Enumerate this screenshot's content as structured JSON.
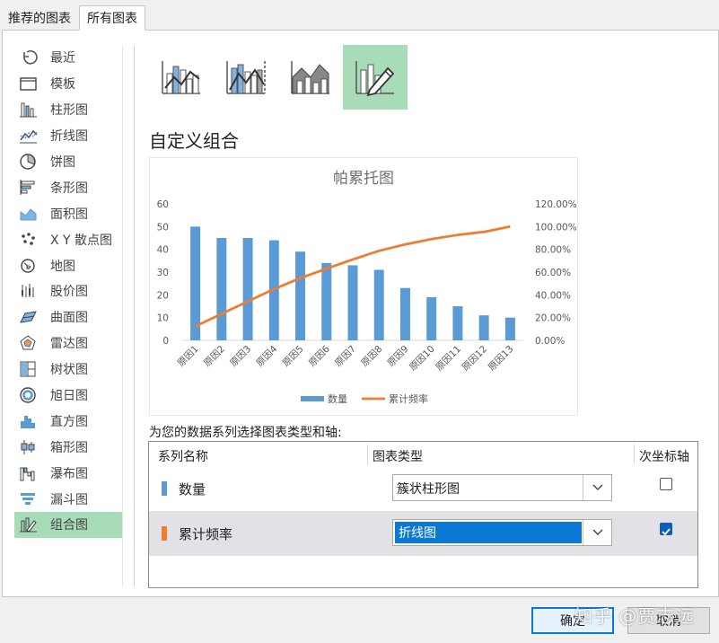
{
  "tabs": [
    {
      "label": "推荐的图表"
    },
    {
      "label": "所有图表"
    }
  ],
  "categories": [
    {
      "label": "最近",
      "icon": "recent-icon"
    },
    {
      "label": "模板",
      "icon": "template-folder-icon"
    },
    {
      "label": "柱形图",
      "icon": "column-chart-icon"
    },
    {
      "label": "折线图",
      "icon": "line-chart-icon"
    },
    {
      "label": "饼图",
      "icon": "pie-chart-icon"
    },
    {
      "label": "条形图",
      "icon": "bar-chart-icon"
    },
    {
      "label": "面积图",
      "icon": "area-chart-icon"
    },
    {
      "label": "X Y 散点图",
      "icon": "scatter-chart-icon"
    },
    {
      "label": "地图",
      "icon": "map-chart-icon"
    },
    {
      "label": "股价图",
      "icon": "stock-chart-icon"
    },
    {
      "label": "曲面图",
      "icon": "surface-chart-icon"
    },
    {
      "label": "雷达图",
      "icon": "radar-chart-icon"
    },
    {
      "label": "树状图",
      "icon": "treemap-chart-icon"
    },
    {
      "label": "旭日图",
      "icon": "sunburst-chart-icon"
    },
    {
      "label": "直方图",
      "icon": "histogram-chart-icon"
    },
    {
      "label": "箱形图",
      "icon": "box-whisker-chart-icon"
    },
    {
      "label": "瀑布图",
      "icon": "waterfall-chart-icon"
    },
    {
      "label": "漏斗图",
      "icon": "funnel-chart-icon"
    },
    {
      "label": "组合图",
      "icon": "combo-chart-icon"
    }
  ],
  "selected_category": "组合图",
  "section_title": "自定义组合",
  "instruction": "为您的数据系列选择图表类型和轴:",
  "table": {
    "headers": {
      "name": "系列名称",
      "type": "图表类型",
      "secondary": "次坐标轴"
    },
    "rows": [
      {
        "name": "数量",
        "type": "簇状柱形图",
        "secondary": false,
        "color": "#5b9bd5"
      },
      {
        "name": "累计频率",
        "type": "折线图",
        "secondary": true,
        "color": "#ed7d31"
      }
    ]
  },
  "buttons": {
    "ok": "确定",
    "cancel": "取消"
  },
  "watermark": "知乎 @贾志远",
  "colors": {
    "bar": "#5b9bd5",
    "line": "#ed7d31",
    "selected_green": "#a8dbb8",
    "focus_blue": "#0b78d7"
  },
  "chart_data": {
    "type": "bar",
    "title": "帕累托图",
    "categories": [
      "原因1",
      "原因2",
      "原因3",
      "原因4",
      "原因5",
      "原因6",
      "原因7",
      "原因8",
      "原因9",
      "原因10",
      "原因11",
      "原因12",
      "原因13"
    ],
    "series": [
      {
        "name": "数量",
        "type": "bar",
        "axis": "left",
        "values": [
          50,
          45,
          45,
          44,
          39,
          34,
          33,
          31,
          23,
          19,
          15,
          11,
          10
        ]
      },
      {
        "name": "累计频率",
        "type": "line",
        "axis": "right",
        "values": [
          12.3,
          23.3,
          34.3,
          45.1,
          54.7,
          63.0,
          71.1,
          78.7,
          84.4,
          89.0,
          92.7,
          95.4,
          100.0
        ]
      }
    ],
    "ylim": [
      0,
      60
    ],
    "yticks": [
      "0",
      "10",
      "20",
      "30",
      "40",
      "50",
      "60"
    ],
    "y2lim": [
      0,
      120
    ],
    "y2ticks": [
      "0.00%",
      "20.00%",
      "40.00%",
      "60.00%",
      "80.00%",
      "100.00%",
      "120.00%"
    ],
    "legend": "bottom",
    "grid": false
  }
}
